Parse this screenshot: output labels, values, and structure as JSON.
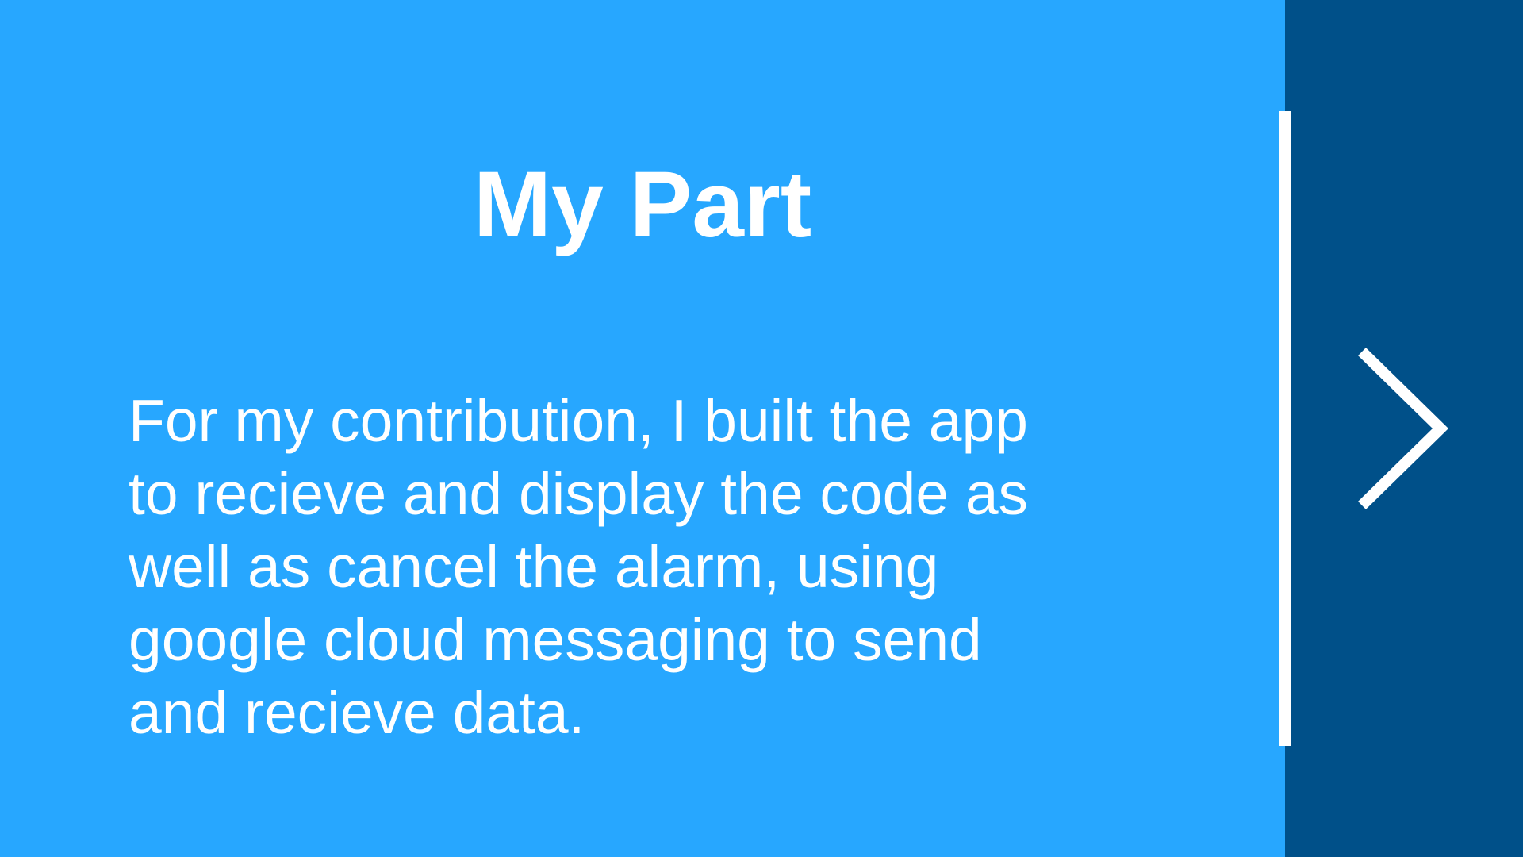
{
  "slide": {
    "title": "My Part",
    "body_lines": [
      "For my contribution, I built the app",
      "to recieve and display the code as",
      "well as cancel the alarm, using",
      "google cloud messaging to send",
      "and recieve data."
    ]
  },
  "navigation": {
    "next_icon": "chevron-right-icon"
  },
  "colors": {
    "background": "#27A7FF",
    "side_panel": "#005089",
    "text": "#FFFFFF",
    "divider": "#FFFFFF"
  }
}
